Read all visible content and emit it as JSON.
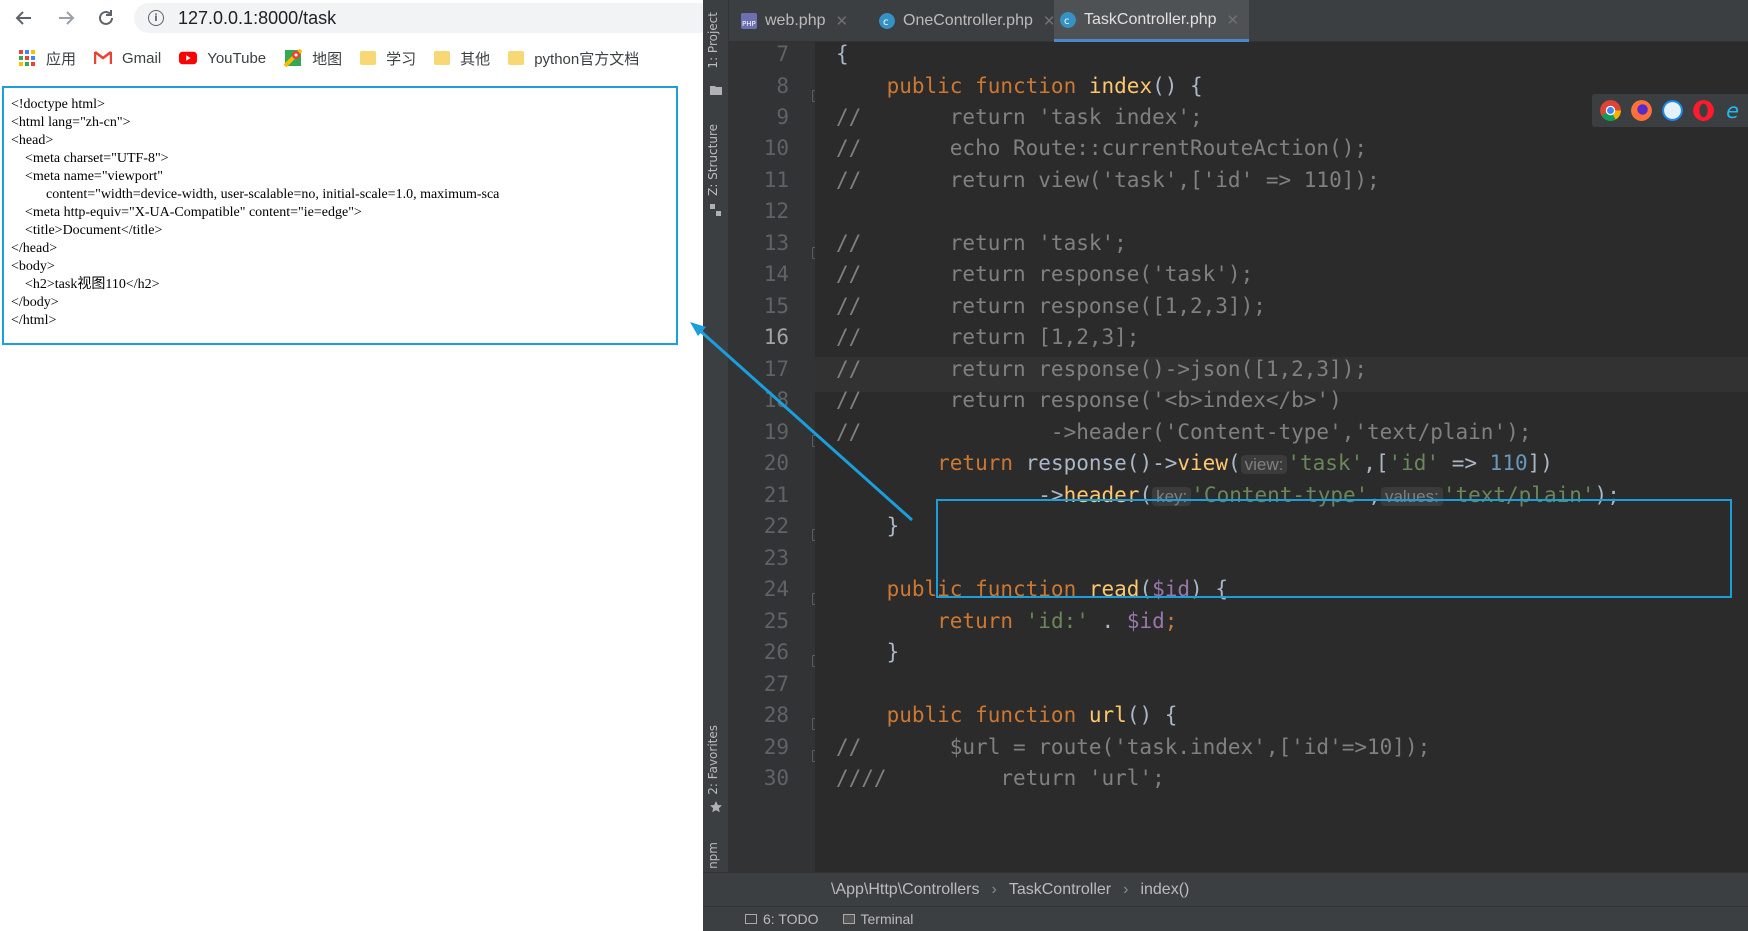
{
  "browser": {
    "url": "127.0.0.1:8000/task",
    "bookmarks": [
      {
        "label": "应用",
        "icon": "apps-grid-icon"
      },
      {
        "label": "Gmail",
        "icon": "gmail-icon"
      },
      {
        "label": "YouTube",
        "icon": "youtube-icon"
      },
      {
        "label": "地图",
        "icon": "maps-icon"
      },
      {
        "label": "学习",
        "icon": "folder-icon"
      },
      {
        "label": "其他",
        "icon": "folder-icon"
      },
      {
        "label": "python官方文档",
        "icon": "folder-icon"
      }
    ],
    "page_source": "<!doctype html>\n<html lang=\"zh-cn\">\n<head>\n    <meta charset=\"UTF-8\">\n    <meta name=\"viewport\"\n          content=\"width=device-width, user-scalable=no, initial-scale=1.0, maximum-sca\n    <meta http-equiv=\"X-UA-Compatible\" content=\"ie=edge\">\n    <title>Document</title>\n</head>\n<body>\n    <h2>task视图110</h2>\n</body>\n</html>"
  },
  "ide": {
    "side_panels": [
      "1: Project",
      "Z: Structure",
      "2: Favorites",
      "npm"
    ],
    "tabs": [
      {
        "label": "web.php",
        "active": false
      },
      {
        "label": "OneController.php",
        "active": false
      },
      {
        "label": "TaskController.php",
        "active": true
      }
    ],
    "line_numbers": [
      "7",
      "8",
      "9",
      "10",
      "11",
      "12",
      "13",
      "14",
      "15",
      "16",
      "17",
      "18",
      "19",
      "20",
      "21",
      "22",
      "23",
      "24",
      "25",
      "26",
      "27",
      "28",
      "29",
      "30"
    ],
    "current_line": "16",
    "code": {
      "l7": "{",
      "l8_kw": "    public function ",
      "l8_fn": "index",
      "l8_rest": "() {",
      "l9": "//       return 'task index';",
      "l10": "//       echo Route::currentRouteAction();",
      "l11": "//       return view('task',['id' => 110]);",
      "l13": "//       return 'task';",
      "l14": "//       return response('task');",
      "l15": "//       return response([1,2,3]);",
      "l16": "//       return [1,2,3];",
      "l17": "//       return response()->json([1,2,3]);",
      "l18": "//       return response('<b>index</b>')",
      "l19": "//               ->header('Content-type','text/plain');",
      "l20_kw": "        return",
      "l20_a": " response()->",
      "l20_fn": "view",
      "l20_b": "(",
      "l20_hint": "view:",
      "l20_str1": "'task'",
      "l20_c": ",[",
      "l20_str2": "'id'",
      "l20_d": " => ",
      "l20_num": "110",
      "l20_e": "])",
      "l21_a": "                ->",
      "l21_fn": "header",
      "l21_b": "(",
      "l21_hint1": "key:",
      "l21_str1": "'Content-type'",
      "l21_c": ",",
      "l21_hint2": "values:",
      "l21_str2": "'text/plain'",
      "l21_d": ");",
      "l22": "    }",
      "l24_kw": "    public function ",
      "l24_fn": "read",
      "l24_a": "(",
      "l24_var": "$id",
      "l24_b": ") {",
      "l25_kw": "        return",
      "l25_str": " 'id:'",
      "l25_a": " . ",
      "l25_var": "$id",
      "l25_b": ";",
      "l26": "    }",
      "l28_kw": "    public function ",
      "l28_fn": "url",
      "l28_rest": "() {",
      "l29": "//       $url = route('task.index',['id'=>10]);",
      "l30": "////         return 'url';"
    },
    "breadcrumb": [
      "\\App\\Http\\Controllers",
      "TaskController",
      "index()"
    ],
    "status_items": [
      {
        "label": "6: TODO",
        "icon": "todo-list-icon"
      },
      {
        "label": "Terminal",
        "icon": "terminal-icon"
      }
    ],
    "browser_icons": [
      "chrome-icon",
      "firefox-icon",
      "safari-icon",
      "opera-icon",
      "ie-icon"
    ]
  },
  "colors": {
    "annotation_blue": "#1a9fdc",
    "ide_background": "#2b2b2b",
    "keyword": "#cc7832",
    "function": "#ffc66d",
    "string": "#6a8759",
    "number": "#6897bb",
    "comment": "#808080"
  }
}
